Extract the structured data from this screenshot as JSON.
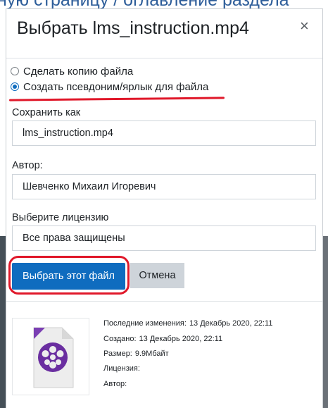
{
  "background": {
    "heading_fragment": "ную страницу / оглавление раздела"
  },
  "dialog": {
    "title": "Выбрать lms_instruction.mp4",
    "close_glyph": "×",
    "options": {
      "copy_label": "Сделать копию файла",
      "alias_label": "Создать псевдоним/ярлык для файла",
      "selected": "alias"
    },
    "save_as": {
      "label": "Сохранить как",
      "value": "lms_instruction.mp4"
    },
    "author": {
      "label": "Автор:",
      "value": "Шевченко Михаил Игоревич"
    },
    "license": {
      "label": "Выберите лицензию",
      "value": "Все права защищены"
    },
    "buttons": {
      "select_label": "Выбрать этот файл",
      "cancel_label": "Отмена"
    },
    "file_info": {
      "modified_label": "Последние изменения:",
      "modified_value": "13 Декабрь 2020, 22:11",
      "created_label": "Создано:",
      "created_value": "13 Декабрь 2020, 22:11",
      "size_label": "Размер:",
      "size_value": "9.9Мбайт",
      "license_label": "Лицензия:",
      "author_label": "Автор:"
    },
    "thumbnail_icon": "video-file-icon"
  },
  "colors": {
    "primary": "#0f6cbf",
    "annotation_red": "#e0182a",
    "video_icon_purple": "#6a2ea0"
  }
}
